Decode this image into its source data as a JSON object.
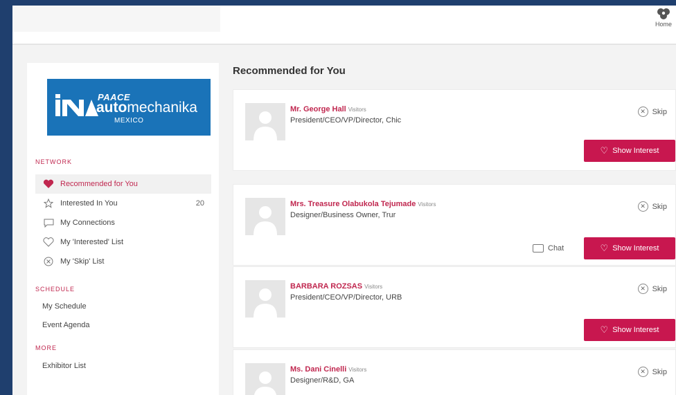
{
  "header": {
    "home_label": "Home"
  },
  "logo": {
    "line1": "PAACE",
    "line2_bold": "auto",
    "line2_rest": "mechanika",
    "line3": "MEXICO"
  },
  "sidebar": {
    "network_title": "NETWORK",
    "network_items": [
      {
        "label": "Recommended for You",
        "icon": "heart-icon",
        "active": true
      },
      {
        "label": "Interested In You",
        "icon": "star-icon",
        "count": "20"
      },
      {
        "label": "My Connections",
        "icon": "chat-icon"
      },
      {
        "label": "My 'Interested' List",
        "icon": "heart-outline-icon"
      },
      {
        "label": "My 'Skip' List",
        "icon": "x-circle-icon"
      }
    ],
    "schedule_title": "SCHEDULE",
    "schedule_items": [
      "My Schedule",
      "Event Agenda"
    ],
    "more_title": "MORE",
    "more_items": [
      "Exhibitor List"
    ]
  },
  "main": {
    "heading": "Recommended for You",
    "skip_label": "Skip",
    "show_interest_label": "Show Interest",
    "chat_label": "Chat",
    "people": [
      {
        "name": "Mr. George Hall",
        "type": "Visitors",
        "title": "President/CEO/VP/Director, Chic",
        "chat": false
      },
      {
        "name": "Mrs. Treasure Olabukola Tejumade",
        "type": "Visitors",
        "title": "Designer/Business Owner, Trur",
        "chat": true
      },
      {
        "name": "BARBARA ROZSAS",
        "type": "Visitors",
        "title": "President/CEO/VP/Director, URB",
        "chat": false
      },
      {
        "name": "Ms. Dani Cinelli",
        "type": "Visitors",
        "title": "Designer/R&D, GA",
        "chat": false
      }
    ]
  },
  "colors": {
    "accent": "#c8174f",
    "brand_blue": "#1a73b8",
    "background_navy": "#1f3f6e"
  }
}
